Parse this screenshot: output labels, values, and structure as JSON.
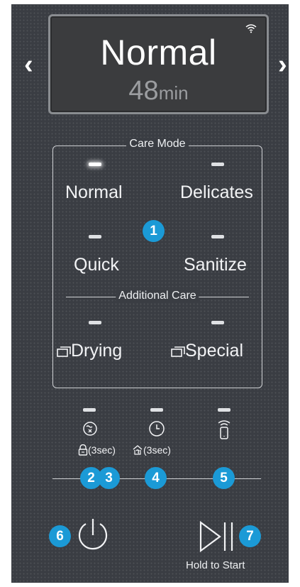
{
  "display": {
    "mode": "Normal",
    "time_value": "48",
    "time_unit": "min"
  },
  "icons": {
    "wifi": "wifi-icon",
    "prev": "chevron-left-icon",
    "next": "chevron-right-icon",
    "dry": "dry-icon",
    "timer": "delay-end-timer-icon",
    "smart_control": "smart-control-icon",
    "child_lock": "child-lock-icon",
    "alarm": "alarm-icon",
    "power": "power-icon",
    "start": "start-pause-icon"
  },
  "care_mode": {
    "title": "Care Mode",
    "options": [
      {
        "label": "Normal",
        "active": true
      },
      {
        "label": "Delicates",
        "active": false
      },
      {
        "label": "Quick",
        "active": false
      },
      {
        "label": "Sanitize",
        "active": false
      }
    ],
    "badge": "1"
  },
  "additional_care": {
    "title": "Additional Care",
    "options": [
      {
        "label": "Drying",
        "active": false
      },
      {
        "label": "Special",
        "active": false
      }
    ]
  },
  "controls": {
    "child_lock_label": "(3sec)",
    "alarm_label": "(3sec)",
    "hold_to_start": "Hold to Start"
  },
  "badges": [
    "1",
    "2",
    "3",
    "4",
    "5",
    "6",
    "7"
  ],
  "colors": {
    "panel": "#3a3d43",
    "display_bg": "#3b3c3e",
    "badge": "#1b9ad6",
    "text": "#ffffff"
  }
}
